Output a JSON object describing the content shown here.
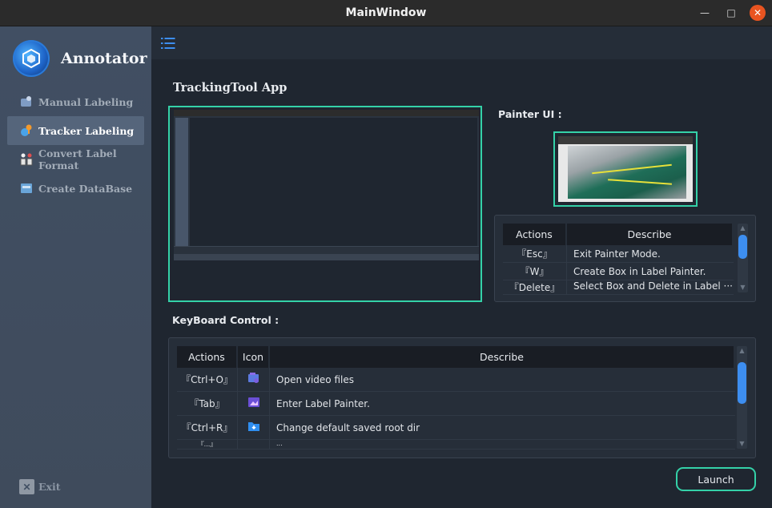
{
  "window": {
    "title": "MainWindow",
    "minimize": "—",
    "maximize": "□",
    "close": "✕"
  },
  "sidebar": {
    "app_name": "Annotator",
    "items": [
      {
        "label": "Manual Labeling",
        "icon": "hand-label-icon",
        "active": false
      },
      {
        "label": "Tracker Labeling",
        "icon": "tracker-icon",
        "active": true
      },
      {
        "label": "Convert Label Format",
        "icon": "convert-icon",
        "active": false
      },
      {
        "label": "Create DataBase",
        "icon": "database-icon",
        "active": false
      }
    ],
    "exit_label": "Exit"
  },
  "main": {
    "app_heading": "TrackingTool App",
    "painter_heading": "Painter UI :",
    "keyboard_heading": "KeyBoard Control :",
    "launch_label": "Launch"
  },
  "painter_table": {
    "headers": [
      "Actions",
      "Describe"
    ],
    "rows": [
      {
        "action": "『Esc』",
        "describe": "Exit Painter Mode."
      },
      {
        "action": "『W』",
        "describe": "Create Box in Label Painter."
      },
      {
        "action": "『Delete』",
        "describe": "Select Box and Delete in Label ···"
      }
    ]
  },
  "keyboard_table": {
    "headers": [
      "Actions",
      "Icon",
      "Describe"
    ],
    "rows": [
      {
        "action": "『Ctrl+O』",
        "icon": "open-video-icon",
        "describe": "Open video files"
      },
      {
        "action": "『Tab』",
        "icon": "label-painter-icon",
        "describe": "Enter Label Painter."
      },
      {
        "action": "『Ctrl+R』",
        "icon": "folder-download-icon",
        "describe": "Change default saved root dir"
      },
      {
        "action": "『...』",
        "icon": "files-icon",
        "describe": "..."
      }
    ]
  },
  "colors": {
    "accent": "#34d1a8",
    "scroll_thumb": "#3d8ef0",
    "sidebar": "#414f63",
    "background": "#1f2630"
  }
}
